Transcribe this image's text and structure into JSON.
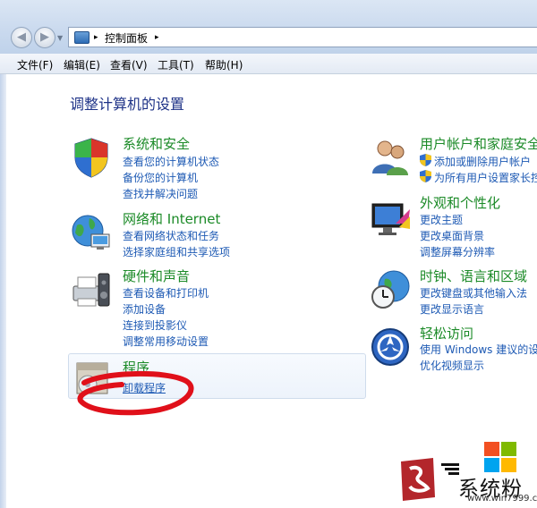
{
  "address_bar": {
    "breadcrumb": [
      "控制面板"
    ],
    "separator": "▸"
  },
  "menubar": {
    "items": [
      "文件(F)",
      "编辑(E)",
      "查看(V)",
      "工具(T)",
      "帮助(H)"
    ]
  },
  "page": {
    "heading": "调整计算机的设置"
  },
  "categories": {
    "system_security": {
      "title": "系统和安全",
      "links": [
        "查看您的计算机状态",
        "备份您的计算机",
        "查找并解决问题"
      ]
    },
    "network": {
      "title": "网络和 Internet",
      "links": [
        "查看网络状态和任务",
        "选择家庭组和共享选项"
      ]
    },
    "hardware": {
      "title": "硬件和声音",
      "links": [
        "查看设备和打印机",
        "添加设备",
        "连接到投影仪",
        "调整常用移动设置"
      ]
    },
    "programs": {
      "title": "程序",
      "links": [
        "卸载程序"
      ]
    },
    "user_accounts": {
      "title": "用户帐户和家庭安全",
      "links": [
        "添加或删除用户帐户",
        "为所有用户设置家长控"
      ]
    },
    "appearance": {
      "title": "外观和个性化",
      "links": [
        "更改主题",
        "更改桌面背景",
        "调整屏幕分辨率"
      ]
    },
    "clock_region": {
      "title": "时钟、语言和区域",
      "links": [
        "更改键盘或其他输入法",
        "更改显示语言"
      ]
    },
    "ease_access": {
      "title": "轻松访问",
      "links": [
        "使用 Windows 建议的设",
        "优化视频显示"
      ]
    }
  },
  "watermark": {
    "text": "系统粉",
    "url": "www.win7999.com"
  },
  "colors": {
    "category_title": "#1b8a27",
    "link": "#1e5ab4",
    "heading": "#1e3287",
    "annotation": "#e0101a"
  }
}
